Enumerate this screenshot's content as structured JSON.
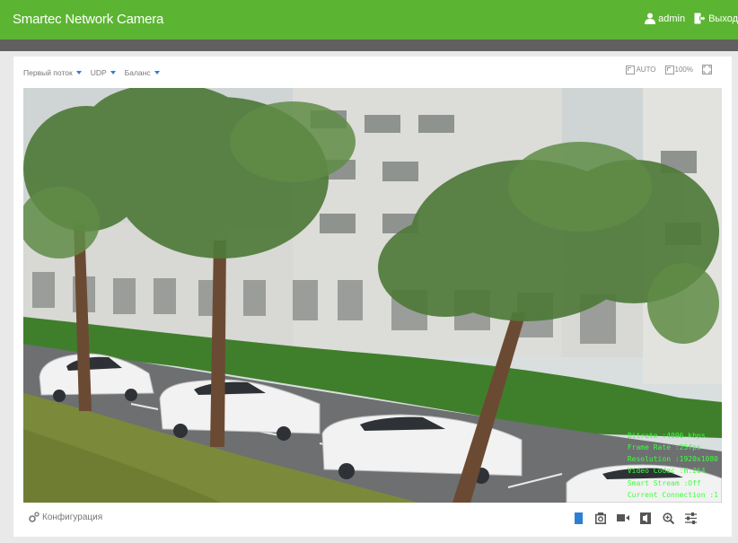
{
  "header": {
    "title": "Smartec Network Camera",
    "user": "admin",
    "logout": "Выход"
  },
  "toolbar": {
    "stream": "Первый поток",
    "protocol": "UDP",
    "mode": "Баланс",
    "view_auto": "AUTO",
    "view_100": "100%"
  },
  "osd": {
    "line1": "Bitrate :4096 kbps",
    "line2": "Frame Rate :25fps",
    "line3": "Resolution :1920x1080",
    "line4": "Video Codec :H.264",
    "line5": "Smart Stream :Off",
    "line6": "Current Connection :1"
  },
  "footer": {
    "config_label": "Конфигурация"
  },
  "colors": {
    "header_green": "#5cb532",
    "accent_blue": "#2d7fd4",
    "osd_green": "#3dff3d"
  }
}
